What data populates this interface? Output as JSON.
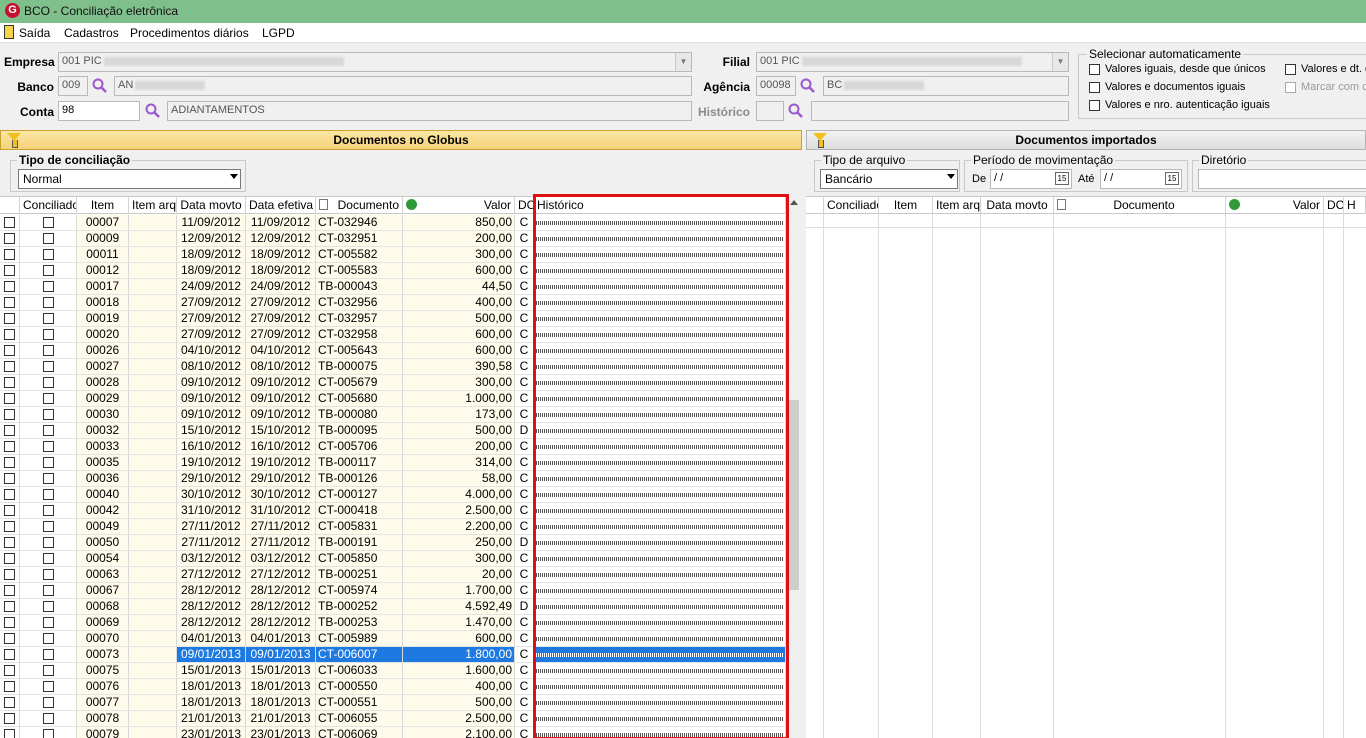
{
  "window": {
    "title": "BCO - Conciliação eletrônica"
  },
  "menu": [
    "Saída",
    "Cadastros",
    "Procedimentos diários",
    "LGPD"
  ],
  "form": {
    "empresa_label": "Empresa",
    "empresa_value": "001 PIC",
    "banco_label": "Banco",
    "banco_code": "009",
    "banco_name": "AN",
    "conta_label": "Conta",
    "conta_value": "98",
    "conta_desc": "ADIANTAMENTOS",
    "filial_label": "Filial",
    "filial_value": "001 PIC",
    "agencia_label": "Agência",
    "agencia_code": "00098",
    "agencia_name": "BC",
    "historico_label": "Histórico"
  },
  "auto_select": {
    "title": "Selecionar automaticamente",
    "options": [
      {
        "label": "Valores iguais, desde que únicos",
        "checked": false,
        "enabled": true
      },
      {
        "label": "Valores e documentos iguais",
        "checked": false,
        "enabled": true
      },
      {
        "label": "Valores e nro. autenticação iguais",
        "checked": false,
        "enabled": true
      },
      {
        "label": "Valores e dt. d",
        "checked": false,
        "enabled": true
      },
      {
        "label": "Marcar com c",
        "checked": false,
        "enabled": false
      }
    ]
  },
  "left_panel": {
    "title": "Documentos no Globus",
    "conciliation_type_label": "Tipo de conciliação",
    "conciliation_type_value": "Normal",
    "columns": [
      "Conciliado",
      "Item",
      "Item arq",
      "Data movto",
      "Data efetiva",
      "Documento",
      "Valor",
      "DC",
      "Histórico"
    ],
    "rows": [
      {
        "item": "00007",
        "data_movto": "11/09/2012",
        "data_efetiva": "11/09/2012",
        "documento": "CT-032946",
        "valor": "850,00",
        "dc": "C"
      },
      {
        "item": "00009",
        "data_movto": "12/09/2012",
        "data_efetiva": "12/09/2012",
        "documento": "CT-032951",
        "valor": "200,00",
        "dc": "C"
      },
      {
        "item": "00011",
        "data_movto": "18/09/2012",
        "data_efetiva": "18/09/2012",
        "documento": "CT-005582",
        "valor": "300,00",
        "dc": "C"
      },
      {
        "item": "00012",
        "data_movto": "18/09/2012",
        "data_efetiva": "18/09/2012",
        "documento": "CT-005583",
        "valor": "600,00",
        "dc": "C"
      },
      {
        "item": "00017",
        "data_movto": "24/09/2012",
        "data_efetiva": "24/09/2012",
        "documento": "TB-000043",
        "valor": "44,50",
        "dc": "C"
      },
      {
        "item": "00018",
        "data_movto": "27/09/2012",
        "data_efetiva": "27/09/2012",
        "documento": "CT-032956",
        "valor": "400,00",
        "dc": "C"
      },
      {
        "item": "00019",
        "data_movto": "27/09/2012",
        "data_efetiva": "27/09/2012",
        "documento": "CT-032957",
        "valor": "500,00",
        "dc": "C"
      },
      {
        "item": "00020",
        "data_movto": "27/09/2012",
        "data_efetiva": "27/09/2012",
        "documento": "CT-032958",
        "valor": "600,00",
        "dc": "C"
      },
      {
        "item": "00026",
        "data_movto": "04/10/2012",
        "data_efetiva": "04/10/2012",
        "documento": "CT-005643",
        "valor": "600,00",
        "dc": "C"
      },
      {
        "item": "00027",
        "data_movto": "08/10/2012",
        "data_efetiva": "08/10/2012",
        "documento": "TB-000075",
        "valor": "390,58",
        "dc": "C"
      },
      {
        "item": "00028",
        "data_movto": "09/10/2012",
        "data_efetiva": "09/10/2012",
        "documento": "CT-005679",
        "valor": "300,00",
        "dc": "C"
      },
      {
        "item": "00029",
        "data_movto": "09/10/2012",
        "data_efetiva": "09/10/2012",
        "documento": "CT-005680",
        "valor": "1.000,00",
        "dc": "C"
      },
      {
        "item": "00030",
        "data_movto": "09/10/2012",
        "data_efetiva": "09/10/2012",
        "documento": "TB-000080",
        "valor": "173,00",
        "dc": "C"
      },
      {
        "item": "00032",
        "data_movto": "15/10/2012",
        "data_efetiva": "15/10/2012",
        "documento": "TB-000095",
        "valor": "500,00",
        "dc": "D"
      },
      {
        "item": "00033",
        "data_movto": "16/10/2012",
        "data_efetiva": "16/10/2012",
        "documento": "CT-005706",
        "valor": "200,00",
        "dc": "C"
      },
      {
        "item": "00035",
        "data_movto": "19/10/2012",
        "data_efetiva": "19/10/2012",
        "documento": "TB-000117",
        "valor": "314,00",
        "dc": "C"
      },
      {
        "item": "00036",
        "data_movto": "29/10/2012",
        "data_efetiva": "29/10/2012",
        "documento": "TB-000126",
        "valor": "58,00",
        "dc": "C"
      },
      {
        "item": "00040",
        "data_movto": "30/10/2012",
        "data_efetiva": "30/10/2012",
        "documento": "CT-000127",
        "valor": "4.000,00",
        "dc": "C"
      },
      {
        "item": "00042",
        "data_movto": "31/10/2012",
        "data_efetiva": "31/10/2012",
        "documento": "CT-000418",
        "valor": "2.500,00",
        "dc": "C"
      },
      {
        "item": "00049",
        "data_movto": "27/11/2012",
        "data_efetiva": "27/11/2012",
        "documento": "CT-005831",
        "valor": "2.200,00",
        "dc": "C"
      },
      {
        "item": "00050",
        "data_movto": "27/11/2012",
        "data_efetiva": "27/11/2012",
        "documento": "TB-000191",
        "valor": "250,00",
        "dc": "D"
      },
      {
        "item": "00054",
        "data_movto": "03/12/2012",
        "data_efetiva": "03/12/2012",
        "documento": "CT-005850",
        "valor": "300,00",
        "dc": "C"
      },
      {
        "item": "00063",
        "data_movto": "27/12/2012",
        "data_efetiva": "27/12/2012",
        "documento": "TB-000251",
        "valor": "20,00",
        "dc": "C"
      },
      {
        "item": "00067",
        "data_movto": "28/12/2012",
        "data_efetiva": "28/12/2012",
        "documento": "CT-005974",
        "valor": "1.700,00",
        "dc": "C"
      },
      {
        "item": "00068",
        "data_movto": "28/12/2012",
        "data_efetiva": "28/12/2012",
        "documento": "TB-000252",
        "valor": "4.592,49",
        "dc": "D"
      },
      {
        "item": "00069",
        "data_movto": "28/12/2012",
        "data_efetiva": "28/12/2012",
        "documento": "TB-000253",
        "valor": "1.470,00",
        "dc": "C"
      },
      {
        "item": "00070",
        "data_movto": "04/01/2013",
        "data_efetiva": "04/01/2013",
        "documento": "CT-005989",
        "valor": "600,00",
        "dc": "C"
      },
      {
        "item": "00073",
        "data_movto": "09/01/2013",
        "data_efetiva": "09/01/2013",
        "documento": "CT-006007",
        "valor": "1.800,00",
        "dc": "C",
        "selected": true
      },
      {
        "item": "00075",
        "data_movto": "15/01/2013",
        "data_efetiva": "15/01/2013",
        "documento": "CT-006033",
        "valor": "1.600,00",
        "dc": "C"
      },
      {
        "item": "00076",
        "data_movto": "18/01/2013",
        "data_efetiva": "18/01/2013",
        "documento": "CT-000550",
        "valor": "400,00",
        "dc": "C"
      },
      {
        "item": "00077",
        "data_movto": "18/01/2013",
        "data_efetiva": "18/01/2013",
        "documento": "CT-000551",
        "valor": "500,00",
        "dc": "C"
      },
      {
        "item": "00078",
        "data_movto": "21/01/2013",
        "data_efetiva": "21/01/2013",
        "documento": "CT-006055",
        "valor": "2.500,00",
        "dc": "C"
      },
      {
        "item": "00079",
        "data_movto": "23/01/2013",
        "data_efetiva": "23/01/2013",
        "documento": "CT-006069",
        "valor": "2.100,00",
        "dc": "C"
      }
    ]
  },
  "right_panel": {
    "title": "Documentos importados",
    "file_type_label": "Tipo de arquivo",
    "file_type_value": "Bancário",
    "period_label": "Período de movimentação",
    "de_label": "De",
    "ate_label": "Até",
    "date_placeholder": " /  /",
    "dir_label": "Diretório",
    "columns": [
      "Conciliado",
      "Item",
      "Item arq",
      "Data movto",
      "Documento",
      "Valor",
      "DC",
      "H"
    ]
  },
  "colors": {
    "titlebar": "#7fbf8c",
    "panel_header": "#f5d27a",
    "selection": "#1e7ae0",
    "highlight_box": "#e01010"
  }
}
